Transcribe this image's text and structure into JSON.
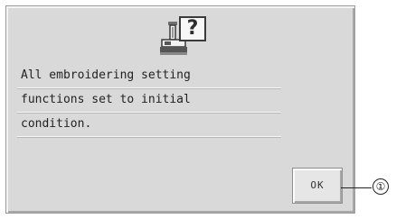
{
  "dialog": {
    "icons": {
      "machine": "embroidery-machine-icon",
      "question": "question-mark-icon",
      "question_symbol": "?"
    },
    "message_lines": [
      "All embroidering setting",
      "functions set to initial",
      "condition."
    ],
    "ok_label": "OK"
  },
  "annotation": {
    "callout_label": "①"
  }
}
